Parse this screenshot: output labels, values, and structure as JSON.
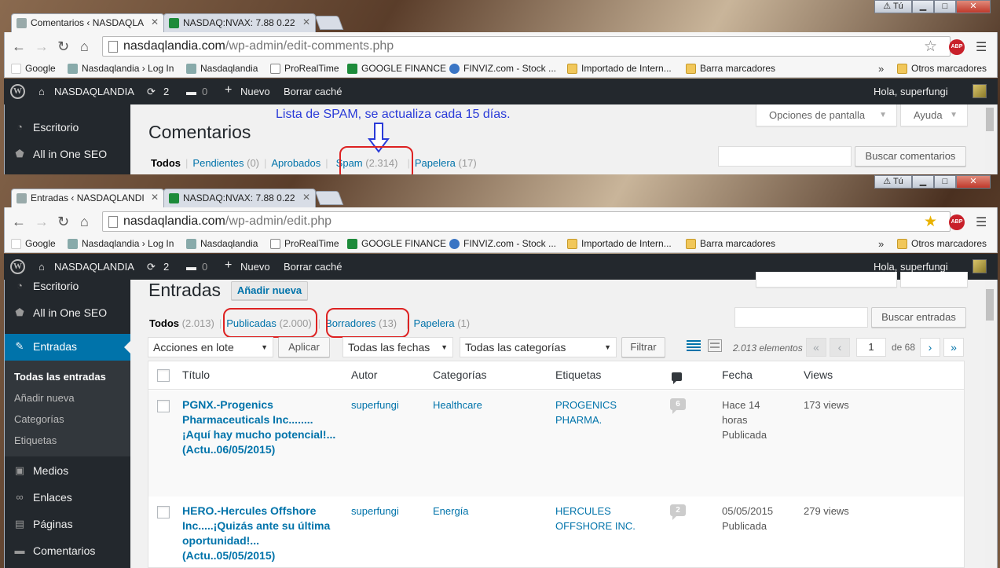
{
  "window1": {
    "tabs": [
      {
        "label": "Comentarios ‹ NASDAQLA",
        "active": true
      },
      {
        "label": "NASDAQ:NVAX: 7.88 0.22",
        "active": false
      }
    ],
    "address": {
      "host": "nasdaqlandia.com",
      "path": "/wp-admin/edit-comments.php"
    },
    "page_title": "Comentarios",
    "screen_options": "Opciones de pantalla",
    "help": "Ayuda",
    "search_button": "Buscar comentarios",
    "annotation": "Lista de SPAM, se actualiza cada 15 días.",
    "filters": {
      "all": "Todos",
      "pending": "Pendientes",
      "pending_count": "(0)",
      "approved": "Aprobados",
      "spam": "Spam",
      "spam_count": "(2.314)",
      "trash": "Papelera",
      "trash_count": "(17)"
    },
    "sidebar": [
      {
        "label": "Escritorio",
        "icon": "dashboard-icon"
      },
      {
        "label": "All in One SEO",
        "icon": "shield-icon"
      }
    ]
  },
  "window2": {
    "tabs": [
      {
        "label": "Entradas ‹ NASDAQLANDI",
        "active": true
      },
      {
        "label": "NASDAQ:NVAX: 7.88 0.22",
        "active": false
      }
    ],
    "address": {
      "host": "nasdaqlandia.com",
      "path": "/wp-admin/edit.php"
    },
    "page_title": "Entradas",
    "add_new": "Añadir nueva",
    "search_button": "Buscar entradas",
    "filters": {
      "all": "Todos",
      "all_count": "(2.013)",
      "published": "Publicadas",
      "published_count": "(2.000)",
      "drafts": "Borradores",
      "drafts_count": "(13)",
      "trash": "Papelera",
      "trash_count": "(1)"
    },
    "bulk_actions": "Acciones en lote",
    "apply": "Aplicar",
    "all_dates": "Todas las fechas",
    "all_categories": "Todas las categorías",
    "filter": "Filtrar",
    "pagination": {
      "items": "2.013 elementos",
      "first": "«",
      "prev": "‹",
      "current": "1",
      "of": "de 68",
      "next": "›",
      "last": "»"
    },
    "columns": {
      "title": "Título",
      "author": "Autor",
      "categories": "Categorías",
      "tags": "Etiquetas",
      "date": "Fecha",
      "views": "Views"
    },
    "posts": [
      {
        "title": "PGNX.-Progenics Pharmaceuticals Inc........ ¡Aquí hay mucho potencial!... (Actu..06/05/2015)",
        "author": "superfungi",
        "category": "Healthcare",
        "tags": "PROGENICS PHARMA.",
        "comments": "6",
        "date": "Hace 14 horas",
        "status": "Publicada",
        "views": "173 views"
      },
      {
        "title": "HERO.-Hercules Offshore Inc.....¡Quizás ante su última oportunidad!... (Actu..05/05/2015)",
        "author": "superfungi",
        "category": "Energía",
        "tags": "HERCULES OFFSHORE INC.",
        "comments": "2",
        "date": "05/05/2015",
        "status": "Publicada",
        "views": "279 views"
      }
    ],
    "sidebar": {
      "escritorio": "Escritorio",
      "seo": "All in One SEO",
      "entradas": "Entradas",
      "sub": [
        "Todas las entradas",
        "Añadir nueva",
        "Categorías",
        "Etiquetas"
      ],
      "medios": "Medios",
      "enlaces": "Enlaces",
      "paginas": "Páginas",
      "comentarios": "Comentarios"
    }
  },
  "browser": {
    "user_badge": "Tú",
    "bookmarks": [
      {
        "label": "Google",
        "icon": "google-icon"
      },
      {
        "label": "Nasdaqlandia › Log In",
        "icon": "wp-icon"
      },
      {
        "label": "Nasdaqlandia",
        "icon": "wp-icon"
      },
      {
        "label": "ProRealTime",
        "icon": "page-icon"
      },
      {
        "label": "GOOGLE FINANCE",
        "icon": "finance-icon"
      },
      {
        "label": "FINVIZ.com - Stock ...",
        "icon": "finviz-icon"
      },
      {
        "label": "Importado de Intern...",
        "icon": "folder-icon"
      },
      {
        "label": "Barra marcadores",
        "icon": "folder-icon"
      }
    ],
    "more": "»",
    "other_bookmarks": "Otros marcadores",
    "adminbar": {
      "site": "NASDAQLANDIA",
      "updates": "2",
      "comments": "0",
      "new": "Nuevo",
      "cache": "Borrar caché",
      "greeting": "Hola, superfungi"
    }
  },
  "colors": {
    "wp_dark": "#23282d",
    "wp_blue": "#0073aa",
    "highlight_red": "#dd2222",
    "annotation_blue": "#2a3bd8"
  }
}
